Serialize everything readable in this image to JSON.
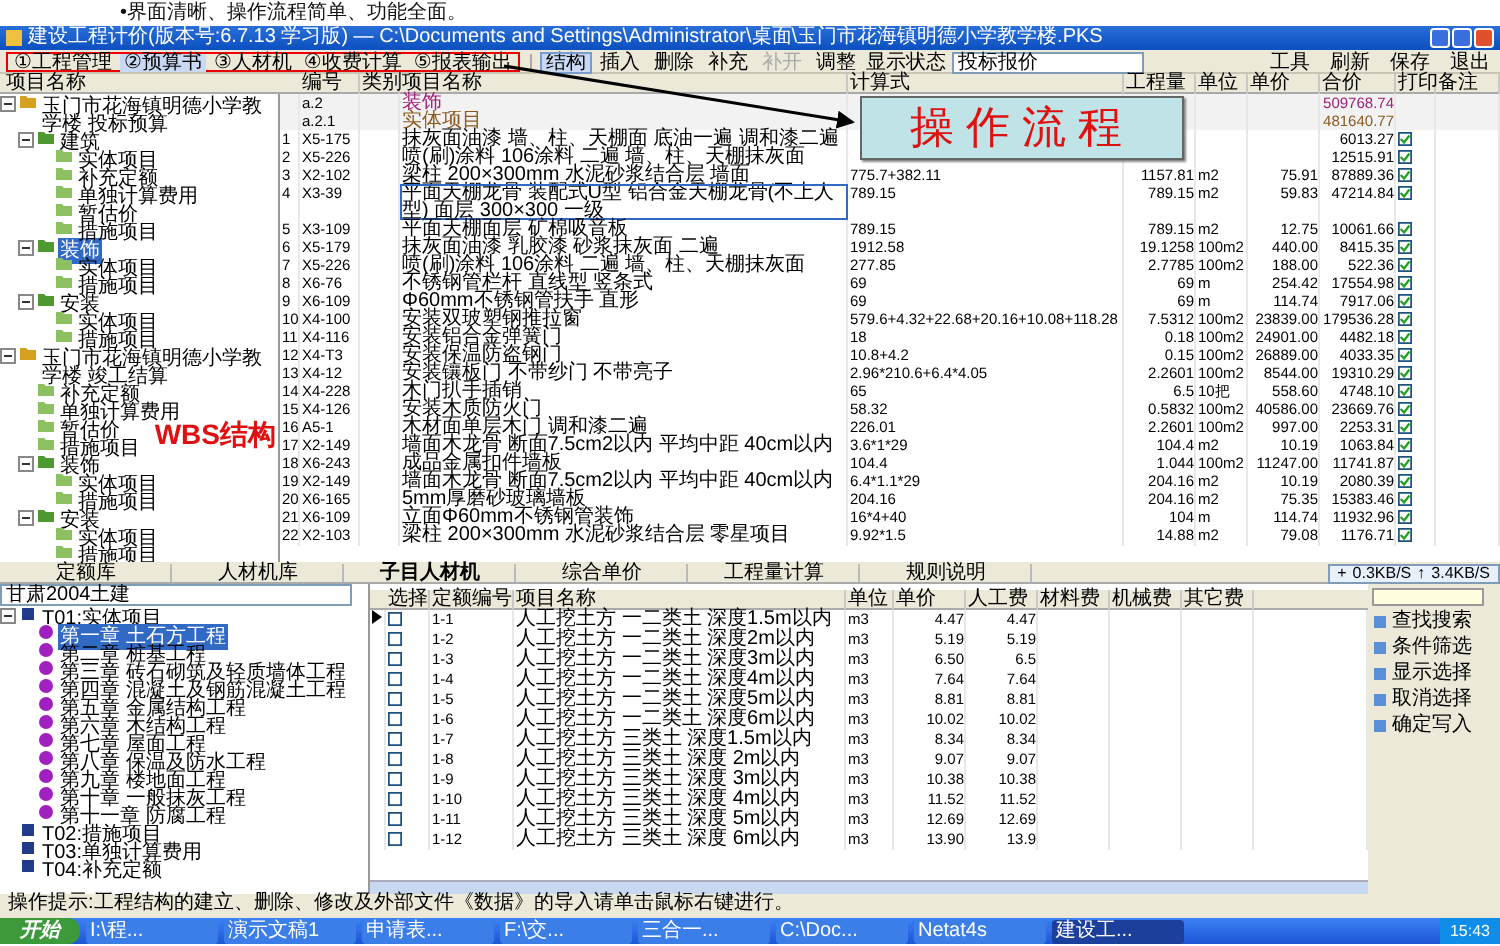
{
  "slide_text": "•界面清晰、操作流程简单、功能全面。",
  "window": {
    "title": "建设工程计价(版本号:6.7.13 学习版) — C:\\Documents and Settings\\Administrator\\桌面\\玉门市花海镇明德小学教学楼.PKS"
  },
  "menu_tabs": [
    {
      "label": "①工程管理",
      "selected": false
    },
    {
      "label": "②预算书",
      "selected": true
    },
    {
      "label": "③人材机",
      "selected": false
    },
    {
      "label": "④收费计算",
      "selected": false
    },
    {
      "label": "⑤报表输出",
      "selected": false
    }
  ],
  "menu_right": [
    "工具",
    "刷新",
    "保存",
    "退出"
  ],
  "toolbar": [
    {
      "label": "结构",
      "selected": true,
      "disabled": false
    },
    {
      "label": "插入",
      "selected": false,
      "disabled": false
    },
    {
      "label": "删除",
      "selected": false,
      "disabled": false
    },
    {
      "label": "补充",
      "selected": false,
      "disabled": false
    },
    {
      "label": "补开",
      "selected": false,
      "disabled": true
    },
    {
      "label": "调整",
      "selected": false,
      "disabled": false
    }
  ],
  "status_select": {
    "label": "显示状态",
    "value": "投标报价"
  },
  "annotations": {
    "callout": "操作流程",
    "wbs": "WBS结构"
  },
  "project_tree": {
    "header": "项目名称",
    "items": [
      {
        "label": "玉门市花海镇明德小学教学楼 投标预算",
        "kind": "project",
        "selected": false,
        "expanded": true,
        "children": [
          {
            "label": "建筑",
            "kind": "folder",
            "selected": false,
            "expanded": true,
            "children": [
              {
                "label": "实体项目",
                "kind": "leaf",
                "selected": false
              },
              {
                "label": "补充定额",
                "kind": "leaf",
                "selected": false
              },
              {
                "label": "单独计算费用",
                "kind": "leaf",
                "selected": false
              },
              {
                "label": "暂估价",
                "kind": "leaf",
                "selected": false
              },
              {
                "label": "措施项目",
                "kind": "leaf",
                "selected": false
              }
            ]
          },
          {
            "label": "装饰",
            "kind": "folder",
            "selected": true,
            "expanded": true,
            "children": [
              {
                "label": "实体项目",
                "kind": "leaf",
                "selected": false
              },
              {
                "label": "措施项目",
                "kind": "leaf",
                "selected": false
              }
            ]
          },
          {
            "label": "安装",
            "kind": "folder",
            "selected": false,
            "expanded": true,
            "children": [
              {
                "label": "实体项目",
                "kind": "leaf",
                "selected": false
              },
              {
                "label": "措施项目",
                "kind": "leaf",
                "selected": false
              }
            ]
          }
        ]
      },
      {
        "label": "玉门市花海镇明德小学教学楼 竣工结算",
        "kind": "project",
        "selected": false,
        "expanded": true,
        "annotated": true,
        "children": [
          {
            "label": "补充定额",
            "kind": "leaf",
            "selected": false
          },
          {
            "label": "单独计算费用",
            "kind": "leaf",
            "selected": false
          },
          {
            "label": "暂估价",
            "kind": "leaf",
            "selected": false
          },
          {
            "label": "措施项目",
            "kind": "leaf",
            "selected": false
          },
          {
            "label": "装饰",
            "kind": "folder",
            "selected": false,
            "expanded": true,
            "children": [
              {
                "label": "实体项目",
                "kind": "leaf",
                "selected": false
              },
              {
                "label": "措施项目",
                "kind": "leaf",
                "selected": false
              }
            ]
          },
          {
            "label": "安装",
            "kind": "folder",
            "selected": false,
            "expanded": true,
            "children": [
              {
                "label": "实体项目",
                "kind": "leaf",
                "selected": false
              },
              {
                "label": "措施项目",
                "kind": "leaf",
                "selected": false
              }
            ]
          }
        ]
      }
    ]
  },
  "grid": {
    "columns": [
      "编号",
      "类别",
      "项目名称",
      "计算式",
      "工程量",
      "单位",
      "单价",
      "合价",
      "打印",
      "备注"
    ],
    "rows": [
      {
        "kind": "group",
        "code": "a.2",
        "name": "装饰",
        "total": "509768.74",
        "selected": false
      },
      {
        "kind": "group",
        "code": "a.2.1",
        "name": "实体项目",
        "total": "481640.77",
        "selected": false
      },
      {
        "kind": "item",
        "no": "1",
        "code": "X5-175",
        "name": "抹灰面油漆 墙、柱、天棚面 底油一遍 调和漆二遍",
        "total": "6013.27",
        "printed": true,
        "selected": false
      },
      {
        "kind": "item",
        "no": "2",
        "code": "X5-226",
        "name": "喷(刷)涂料 106涂料 二遍 墙、柱、天棚抹灰面",
        "total": "12515.91",
        "printed": true,
        "selected": false
      },
      {
        "kind": "item",
        "no": "3",
        "code": "X2-102",
        "name": "梁柱 200×300mm 水泥砂浆结合层 墙面",
        "formula": "775.7+382.11",
        "quantity": "1157.81",
        "unit": "m2",
        "price": "75.91",
        "total": "87889.36",
        "printed": true,
        "selected": false
      },
      {
        "kind": "item",
        "no": "4",
        "code": "X3-39",
        "name": "平面天棚龙骨 装配式U型 铝合金天棚龙骨(不上人型) 面层 300×300 一级",
        "formula": "789.15",
        "quantity": "789.15",
        "unit": "m2",
        "price": "59.83",
        "total": "47214.84",
        "printed": true,
        "selected": true
      },
      {
        "kind": "item",
        "no": "5",
        "code": "X3-109",
        "name": "平面天棚面层 矿棉吸音板",
        "formula": "789.15",
        "quantity": "789.15",
        "unit": "m2",
        "price": "12.75",
        "total": "10061.66",
        "printed": true,
        "selected": false
      },
      {
        "kind": "item",
        "no": "6",
        "code": "X5-179",
        "name": "抹灰面油漆 乳胶漆 砂浆抹灰面 二遍",
        "formula": "1912.58",
        "quantity": "19.1258",
        "unit": "100m2",
        "price": "440.00",
        "total": "8415.35",
        "printed": true,
        "selected": false
      },
      {
        "kind": "item",
        "no": "7",
        "code": "X5-226",
        "name": "喷(刷)涂料 106涂料 二遍 墙、柱、天棚抹灰面",
        "formula": "277.85",
        "quantity": "2.7785",
        "unit": "100m2",
        "price": "188.00",
        "total": "522.36",
        "printed": true,
        "selected": false
      },
      {
        "kind": "item",
        "no": "8",
        "code": "X6-76",
        "name": "不锈钢管栏杆 直线型 竖条式",
        "formula": "69",
        "quantity": "69",
        "unit": "m",
        "price": "254.42",
        "total": "17554.98",
        "printed": true,
        "selected": false
      },
      {
        "kind": "item",
        "no": "9",
        "code": "X6-109",
        "name": "Φ60mm不锈钢管扶手 直形",
        "formula": "69",
        "quantity": "69",
        "unit": "m",
        "price": "114.74",
        "total": "7917.06",
        "printed": true,
        "selected": false
      },
      {
        "kind": "item",
        "no": "10",
        "code": "X4-100",
        "name": "安装双玻塑钢推拉窗",
        "formula": "579.6+4.32+22.68+20.16+10.08+118.28",
        "quantity": "7.5312",
        "unit": "100m2",
        "price": "23839.00",
        "total": "179536.28",
        "printed": true,
        "selected": false
      },
      {
        "kind": "item",
        "no": "11",
        "code": "X4-116",
        "name": "安装铝合金弹簧门",
        "formula": "18",
        "quantity": "0.18",
        "unit": "100m2",
        "price": "24901.00",
        "total": "4482.18",
        "printed": true,
        "selected": false
      },
      {
        "kind": "item",
        "no": "12",
        "code": "X4-T3",
        "name": "安装保温防盗钢门",
        "formula": "10.8+4.2",
        "quantity": "0.15",
        "unit": "100m2",
        "price": "26889.00",
        "total": "4033.35",
        "printed": true,
        "selected": false
      },
      {
        "kind": "item",
        "no": "13",
        "code": "X4-12",
        "name": "安装镶板门 不带纱门 不带亮子",
        "formula": "2.96*210.6+6.4*4.05",
        "quantity": "2.2601",
        "unit": "100m2",
        "price": "8544.00",
        "total": "19310.29",
        "printed": true,
        "selected": false
      },
      {
        "kind": "item",
        "no": "14",
        "code": "X4-228",
        "name": "木门扒手插销",
        "formula": "65",
        "quantity": "6.5",
        "unit": "10把",
        "price": "558.60",
        "total": "4748.10",
        "printed": true,
        "selected": false
      },
      {
        "kind": "item",
        "no": "15",
        "code": "X4-126",
        "name": "安装木质防火门",
        "formula": "58.32",
        "quantity": "0.5832",
        "unit": "100m2",
        "price": "40586.00",
        "total": "23669.76",
        "printed": true,
        "selected": false
      },
      {
        "kind": "item",
        "no": "16",
        "code": "A5-1",
        "name": "木材面单层木门 调和漆二遍",
        "formula": "226.01",
        "quantity": "2.2601",
        "unit": "100m2",
        "price": "997.00",
        "total": "2253.31",
        "printed": true,
        "selected": false
      },
      {
        "kind": "item",
        "no": "17",
        "code": "X2-149",
        "name": "墙面木龙骨 断面7.5cm2以内 平均中距 40cm以内",
        "formula": "3.6*1*29",
        "quantity": "104.4",
        "unit": "m2",
        "price": "10.19",
        "total": "1063.84",
        "printed": true,
        "selected": false
      },
      {
        "kind": "item",
        "no": "18",
        "code": "X6-243",
        "name": "成品金属扣件墙板",
        "formula": "104.4",
        "quantity": "1.044",
        "unit": "100m2",
        "price": "11247.00",
        "total": "11741.87",
        "printed": true,
        "selected": false
      },
      {
        "kind": "item",
        "no": "19",
        "code": "X2-149",
        "name": "墙面木龙骨 断面7.5cm2以内 平均中距 40cm以内",
        "formula": "6.4*1.1*29",
        "quantity": "204.16",
        "unit": "m2",
        "price": "10.19",
        "total": "2080.39",
        "printed": true,
        "selected": false
      },
      {
        "kind": "item",
        "no": "20",
        "code": "X6-165",
        "name": "5mm厚磨砂玻璃墙板",
        "formula": "204.16",
        "quantity": "204.16",
        "unit": "m2",
        "price": "75.35",
        "total": "15383.46",
        "printed": true,
        "selected": false
      },
      {
        "kind": "item",
        "no": "21",
        "code": "X6-109",
        "name": "立面Φ60mm不锈钢管装饰",
        "formula": "16*4+40",
        "quantity": "104",
        "unit": "m",
        "price": "114.74",
        "total": "11932.96",
        "printed": true,
        "selected": false
      },
      {
        "kind": "item",
        "no": "22",
        "code": "X2-103",
        "name": "梁柱 200×300mm 水泥砂浆结合层 零星项目",
        "formula": "9.92*1.5",
        "quantity": "14.88",
        "unit": "m2",
        "price": "79.08",
        "total": "1176.71",
        "printed": true,
        "selected": false
      }
    ]
  },
  "bottom_tabs": [
    {
      "label": "定额库",
      "selected": false
    },
    {
      "label": "人材机库",
      "selected": false
    },
    {
      "label": "子目人材机",
      "selected": true
    },
    {
      "label": "综合单价",
      "selected": false
    },
    {
      "label": "工程量计算",
      "selected": false
    },
    {
      "label": "规则说明",
      "selected": false
    }
  ],
  "net_speed": [
    {
      "sign": "+",
      "rate": "0.3KB/S"
    },
    {
      "sign": "↑",
      "rate": "3.4KB/S"
    }
  ],
  "library_select": "甘肃2004土建",
  "library_tree": [
    {
      "label": "T01:实体项目",
      "selected": false,
      "expanded": true,
      "children": [
        {
          "label": "第一章 土石方工程",
          "selected": true
        },
        {
          "label": "第二章 桩基工程",
          "selected": false
        },
        {
          "label": "第三章 砖石砌筑及轻质墙体工程",
          "selected": false
        },
        {
          "label": "第四章 混凝土及钢筋混凝土工程",
          "selected": false
        },
        {
          "label": "第五章 金属结构工程",
          "selected": false
        },
        {
          "label": "第六章 木结构工程",
          "selected": false
        },
        {
          "label": "第七章 屋面工程",
          "selected": false
        },
        {
          "label": "第八章 保温及防水工程",
          "selected": false
        },
        {
          "label": "第九章 楼地面工程",
          "selected": false
        },
        {
          "label": "第十章 一般抹灰工程",
          "selected": false
        },
        {
          "label": "第十一章 防腐工程",
          "selected": false
        }
      ]
    },
    {
      "label": "T02:措施项目",
      "selected": false
    },
    {
      "label": "T03:单独计算费用",
      "selected": false
    },
    {
      "label": "T04:补充定额",
      "selected": false
    }
  ],
  "quota_grid": {
    "columns": [
      "选择",
      "定额编号",
      "项目名称",
      "单位",
      "单价",
      "人工费",
      "材料费",
      "机械费",
      "其它费"
    ],
    "rows": [
      {
        "code": "1-1",
        "name": "人工挖土方 一二类土 深度1.5m以内",
        "unit": "m3",
        "price": "4.47",
        "labor": "4.47",
        "checked": false,
        "selected": true
      },
      {
        "code": "1-2",
        "name": "人工挖土方 一二类土 深度2m以内",
        "unit": "m3",
        "price": "5.19",
        "labor": "5.19",
        "checked": false,
        "selected": false
      },
      {
        "code": "1-3",
        "name": "人工挖土方 一二类土 深度3m以内",
        "unit": "m3",
        "price": "6.50",
        "labor": "6.5",
        "checked": false,
        "selected": false
      },
      {
        "code": "1-4",
        "name": "人工挖土方 一二类土 深度4m以内",
        "unit": "m3",
        "price": "7.64",
        "labor": "7.64",
        "checked": false,
        "selected": false
      },
      {
        "code": "1-5",
        "name": "人工挖土方 一二类土 深度5m以内",
        "unit": "m3",
        "price": "8.81",
        "labor": "8.81",
        "checked": false,
        "selected": false
      },
      {
        "code": "1-6",
        "name": "人工挖土方 一二类土 深度6m以内",
        "unit": "m3",
        "price": "10.02",
        "labor": "10.02",
        "checked": false,
        "selected": false
      },
      {
        "code": "1-7",
        "name": "人工挖土方 三类土 深度1.5m以内",
        "unit": "m3",
        "price": "8.34",
        "labor": "8.34",
        "checked": false,
        "selected": false
      },
      {
        "code": "1-8",
        "name": "人工挖土方 三类土 深度 2m以内",
        "unit": "m3",
        "price": "9.07",
        "labor": "9.07",
        "checked": false,
        "selected": false
      },
      {
        "code": "1-9",
        "name": "人工挖土方 三类土 深度 3m以内",
        "unit": "m3",
        "price": "10.38",
        "labor": "10.38",
        "checked": false,
        "selected": false
      },
      {
        "code": "1-10",
        "name": "人工挖土方 三类土 深度 4m以内",
        "unit": "m3",
        "price": "11.52",
        "labor": "11.52",
        "checked": false,
        "selected": false
      },
      {
        "code": "1-11",
        "name": "人工挖土方 三类土 深度 5m以内",
        "unit": "m3",
        "price": "12.69",
        "labor": "12.69",
        "checked": false,
        "selected": false
      },
      {
        "code": "1-12",
        "name": "人工挖土方 三类土 深度 6m以内",
        "unit": "m3",
        "price": "13.90",
        "labor": "13.9",
        "checked": false,
        "selected": false
      }
    ]
  },
  "side_actions": [
    "查找搜索",
    "条件筛选",
    "显示选择",
    "取消选择",
    "确定写入"
  ],
  "status_bar": "操作提示:工程结构的建立、删除、修改及外部文件《数据》的导入请单击鼠标右键进行。",
  "taskbar": {
    "start": "开始",
    "tasks": [
      {
        "label": "I:\\程...",
        "selected": false
      },
      {
        "label": "演示文稿1",
        "selected": false
      },
      {
        "label": "申请表...",
        "selected": false
      },
      {
        "label": "F:\\交...",
        "selected": false
      },
      {
        "label": "三合一...",
        "selected": false
      },
      {
        "label": "C:\\Doc...",
        "selected": false
      },
      {
        "label": "Netat4s",
        "selected": false
      },
      {
        "label": "建设工...",
        "selected": true
      }
    ],
    "clock": "15:43"
  }
}
